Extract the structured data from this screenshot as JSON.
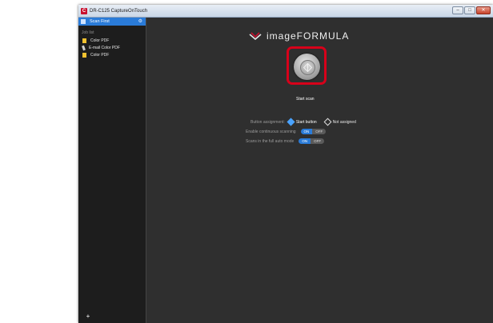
{
  "window": {
    "title": "DR-C125 CaptureOnTouch",
    "controls": {
      "minimize": "–",
      "maximize": "□",
      "close": "✕"
    }
  },
  "sidebar": {
    "scan_first": "Scan First",
    "job_list_label": "Job list",
    "items": [
      {
        "label": "Color PDF",
        "icon": "pdf-icon"
      },
      {
        "label": "E-mail Color PDF",
        "icon": "email-icon"
      },
      {
        "label": "Color PDF",
        "icon": "pdf-icon"
      }
    ],
    "add_label": "+"
  },
  "main": {
    "brand": "imageFORMULA",
    "start_label": "Start scan",
    "button_assignment": {
      "label": "Button assignment:",
      "opt1": "Start button",
      "opt2": "Not assigned"
    },
    "continuous": {
      "label": "Enable continuous scanning",
      "on": "ON",
      "off": "OFF"
    },
    "full_auto": {
      "label": "Scans in the full auto mode",
      "on": "ON",
      "off": "OFF"
    }
  },
  "colors": {
    "accent": "#2a7bd8",
    "highlight_frame": "#d7001a",
    "brand_red": "#c8102e"
  }
}
